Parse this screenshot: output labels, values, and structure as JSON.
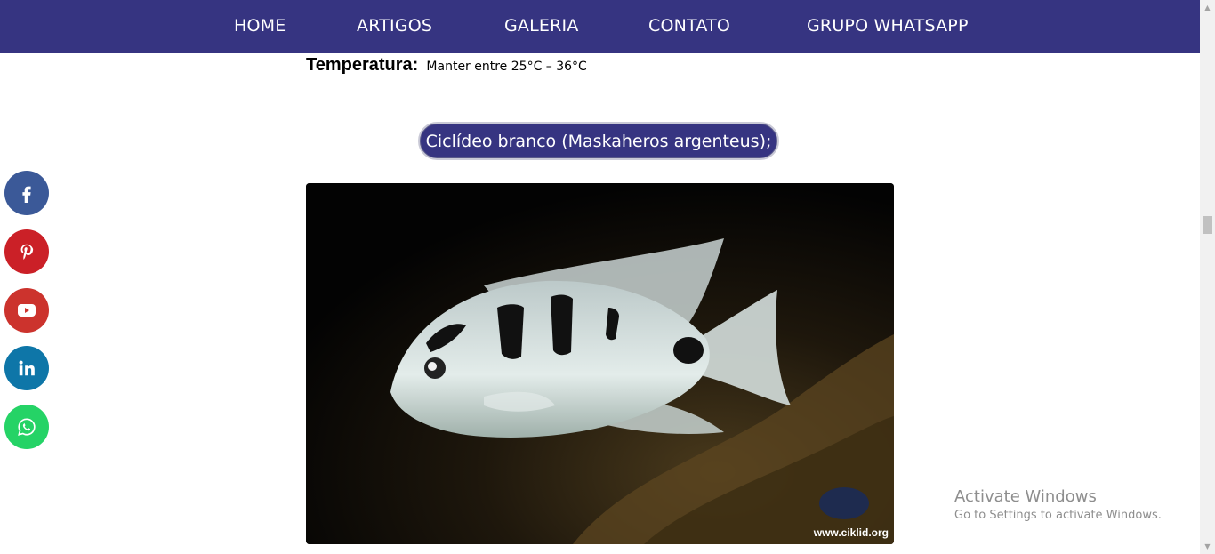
{
  "nav": {
    "items": [
      {
        "label": "HOME"
      },
      {
        "label": "ARTIGOS"
      },
      {
        "label": "GALERIA"
      },
      {
        "label": "CONTATO"
      },
      {
        "label": "GRUPO WHATSAPP"
      }
    ],
    "background": "#363481"
  },
  "content": {
    "temperature_label": "Temperatura:",
    "temperature_value": "Manter entre 25°C – 36°C",
    "species_title": "Ciclídeo branco (Maskaheros argenteus);",
    "image_watermark": "www.ciklid.org"
  },
  "social": [
    {
      "icon": "facebook-icon",
      "color": "#3b5998"
    },
    {
      "icon": "pinterest-icon",
      "color": "#cb2027"
    },
    {
      "icon": "youtube-icon",
      "color": "#cc332d"
    },
    {
      "icon": "linkedin-icon",
      "color": "#0e76a8"
    },
    {
      "icon": "whatsapp-icon",
      "color": "#25d366"
    }
  ],
  "windows_notice": {
    "title": "Activate Windows",
    "subtitle": "Go to Settings to activate Windows."
  }
}
